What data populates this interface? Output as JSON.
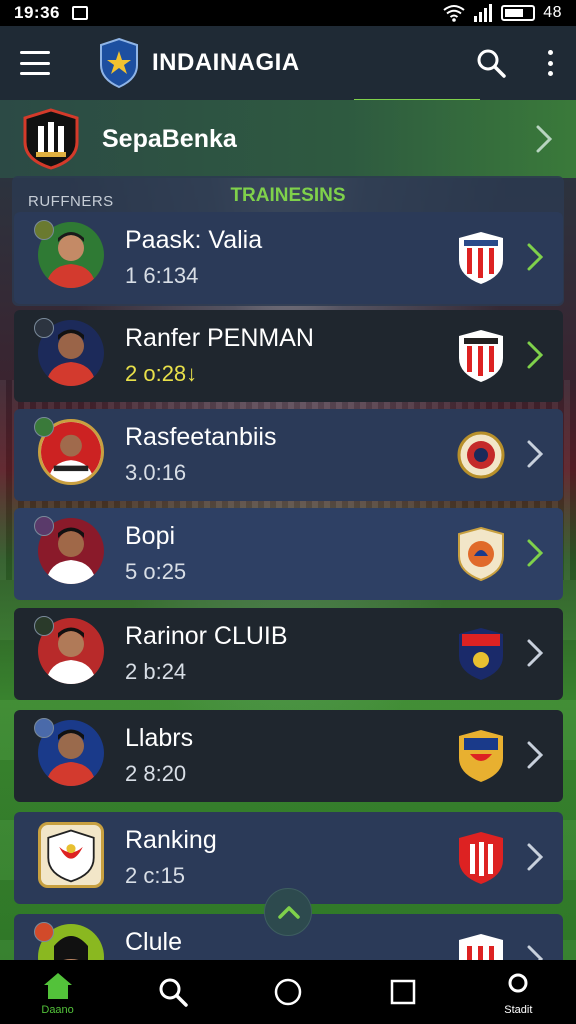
{
  "status_bar": {
    "time": "19:36",
    "battery_text": "48"
  },
  "app_bar": {
    "title": "INDAINAGIA",
    "icons": [
      "menu-icon",
      "shield-star-icon",
      "search-icon",
      "more-vertical-icon"
    ]
  },
  "club": {
    "name": "SepaBenka"
  },
  "list_headers": {
    "left": "RUFFNERS",
    "center": "TRAINESINS"
  },
  "players": [
    {
      "name": "Paask: Valia",
      "score": "1 6:134",
      "highlight": false
    },
    {
      "name": "Ranfer PENMAN",
      "score": "2 o:28",
      "highlight": true,
      "score_suffix": "↓"
    },
    {
      "name": "Rasfeetanbiis",
      "score": "3.0:16",
      "highlight": false
    },
    {
      "name": "Bopi",
      "score": "5 o:25",
      "highlight": false
    },
    {
      "name": "Rarinor CLUIB",
      "score": "2 b:24",
      "highlight": false
    },
    {
      "name": "Llabrs",
      "score": "2 8:20",
      "highlight": false
    },
    {
      "name": "Ranking",
      "score": "2 c:15",
      "highlight": false
    },
    {
      "name": "Clule",
      "score": "",
      "highlight": false
    }
  ],
  "bottom_nav": [
    {
      "label": "Daano",
      "icon": "home-icon"
    },
    {
      "label": "",
      "icon": "search-icon"
    },
    {
      "label": "",
      "icon": "circle-home-icon"
    },
    {
      "label": "",
      "icon": "square-recents-icon"
    },
    {
      "label": "Stadit",
      "icon": "ring-icon"
    }
  ],
  "colors": {
    "accent_green": "#7fd14b",
    "card_blue": "#2b3a58",
    "card_dark": "#1f262e",
    "appbar": "#1f2a35"
  }
}
